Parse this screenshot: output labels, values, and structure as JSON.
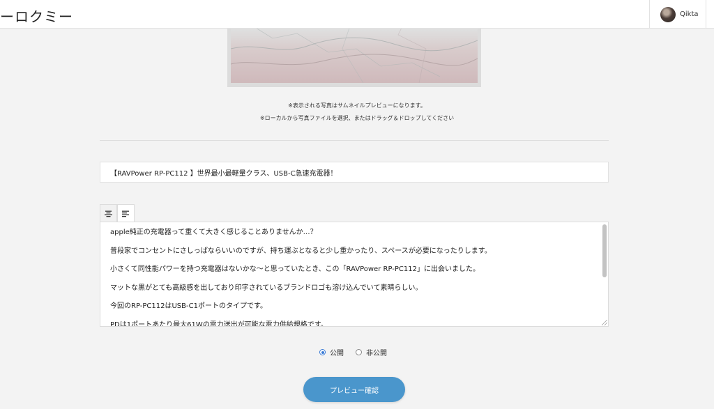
{
  "header": {
    "logo": "ーロクミー",
    "username": "Qikta"
  },
  "photo": {
    "note1": "※表示される写真はサムネイルプレビューになります。",
    "note2": "※ローカルから写真ファイルを選択、またはドラッグ＆ドロップしてください"
  },
  "form": {
    "title_value": "【RAVPower RP-PC112 】世界最小最軽量クラス、USB-C急速充電器！",
    "editor_lines": [
      "apple純正の充電器って重くて大きく感じることありませんか…？",
      "普段家でコンセントにさしっぱならいいのですが、持ち運ぶとなると少し重かったり、スペースが必要になったりします。",
      "小さくて同性能パワーを持つ充電器はないかな〜と思っていたとき、この「RAVPower RP-PC112」に出会いました。",
      "マットな黒がとても高級感を出しており印字されているブランドロゴも溶け込んでいて素晴らしい。",
      "今回のRP-PC112はUSB-C1ポートのタイプです。",
      "PDは1ポートあたり最大61Wの電力送出が可能な電力供給規格です。"
    ],
    "visibility": {
      "public_label": "公開",
      "private_label": "非公開",
      "selected": "公開"
    },
    "preview_button": "プレビュー確認"
  },
  "colors": {
    "accent": "#4a96cc",
    "radio_checked": "#3a7bd5",
    "background": "#f3f3f3"
  },
  "icons": {
    "tab_1": "text-align-center-icon",
    "tab_2": "text-align-left-icon"
  }
}
